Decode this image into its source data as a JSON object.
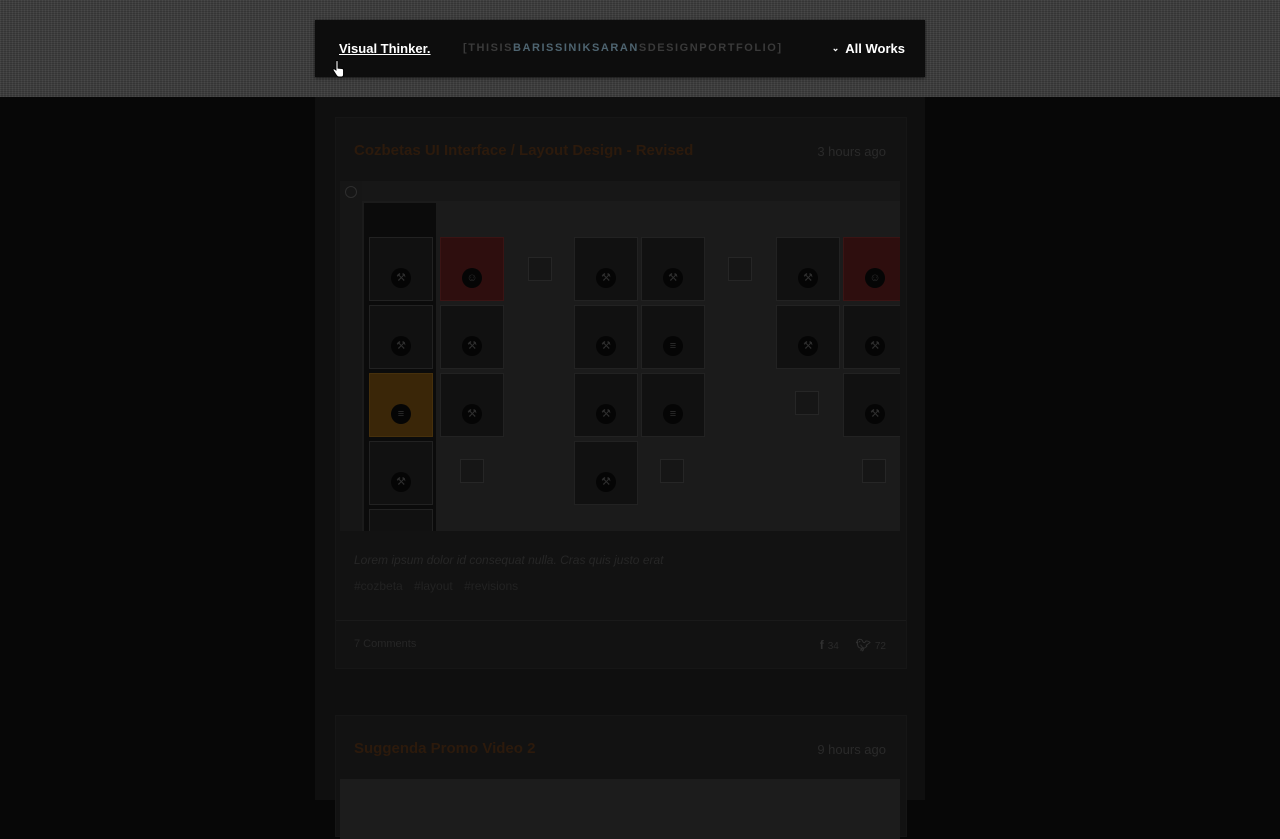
{
  "header": {
    "brand": "Visual Thinker.",
    "tagline": {
      "open": "[",
      "part1": "THISIS",
      "name": "BARISSINIKSARAN",
      "part2": "SDESIGNPORTFOLIO",
      "close": "]"
    },
    "filter_label": "All Works"
  },
  "posts": [
    {
      "title": "Cozbetas UI Interface / Layout Design - Revised",
      "time": "3 hours ago",
      "excerpt": "Lorem ipsum dolor id consequat nulla. Cras quis justo erat",
      "tags": [
        "#cozbeta",
        "#layout",
        "#revisions"
      ],
      "comments": "7 Comments",
      "facebook_count": "34",
      "twitter_count": "72"
    },
    {
      "title": "Suggenda Promo Video 2",
      "time": "9 hours ago"
    }
  ],
  "colors": {
    "title": "#2c1a0c",
    "tagline_highlight": "#4e6470",
    "overlay": "#070707"
  }
}
